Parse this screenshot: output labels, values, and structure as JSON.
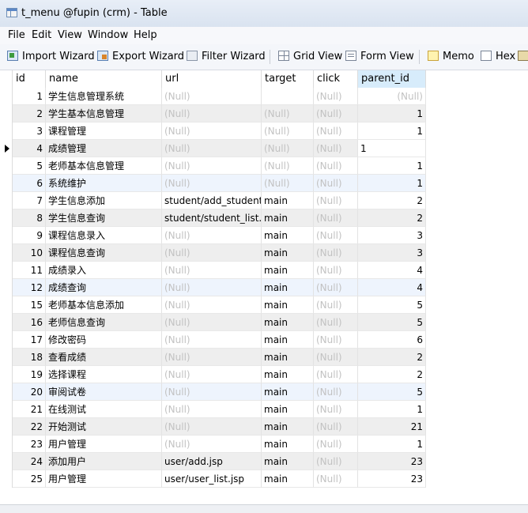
{
  "window": {
    "title": "t_menu @fupin (crm) - Table"
  },
  "menu": [
    "File",
    "Edit",
    "View",
    "Window",
    "Help"
  ],
  "toolbar": {
    "import_wizard": "Import Wizard",
    "export_wizard": "Export Wizard",
    "filter_wizard": "Filter Wizard",
    "grid_view": "Grid View",
    "form_view": "Form View",
    "memo": "Memo",
    "hex": "Hex"
  },
  "table": {
    "columns": [
      "id",
      "name",
      "url",
      "target",
      "click",
      "parent_id"
    ],
    "sorted_column": "parent_id",
    "current_row_index": 3,
    "rows": [
      {
        "id": "1",
        "name": "学生信息管理系统",
        "url": "(Null)",
        "target": "",
        "click": "(Null)",
        "parent_id": "(Null)"
      },
      {
        "id": "2",
        "name": "学生基本信息管理",
        "url": "(Null)",
        "target": "(Null)",
        "click": "(Null)",
        "parent_id": "1"
      },
      {
        "id": "3",
        "name": "课程管理",
        "url": "(Null)",
        "target": "(Null)",
        "click": "(Null)",
        "parent_id": "1"
      },
      {
        "id": "4",
        "name": "成绩管理",
        "url": "(Null)",
        "target": "(Null)",
        "click": "(Null)",
        "parent_id": "1"
      },
      {
        "id": "5",
        "name": "老师基本信息管理",
        "url": "(Null)",
        "target": "(Null)",
        "click": "(Null)",
        "parent_id": "1"
      },
      {
        "id": "6",
        "name": "系统维护",
        "url": "(Null)",
        "target": "(Null)",
        "click": "(Null)",
        "parent_id": "1"
      },
      {
        "id": "7",
        "name": "学生信息添加",
        "url": "student/add_student.",
        "target": "main",
        "click": "(Null)",
        "parent_id": "2"
      },
      {
        "id": "8",
        "name": "学生信息查询",
        "url": "student/student_list.js",
        "target": "main",
        "click": "(Null)",
        "parent_id": "2"
      },
      {
        "id": "9",
        "name": "课程信息录入",
        "url": "(Null)",
        "target": "main",
        "click": "(Null)",
        "parent_id": "3"
      },
      {
        "id": "10",
        "name": "课程信息查询",
        "url": "(Null)",
        "target": "main",
        "click": "(Null)",
        "parent_id": "3"
      },
      {
        "id": "11",
        "name": "成绩录入",
        "url": "(Null)",
        "target": "main",
        "click": "(Null)",
        "parent_id": "4"
      },
      {
        "id": "12",
        "name": "成绩查询",
        "url": "(Null)",
        "target": "main",
        "click": "(Null)",
        "parent_id": "4"
      },
      {
        "id": "15",
        "name": "老师基本信息添加",
        "url": "(Null)",
        "target": "main",
        "click": "(Null)",
        "parent_id": "5"
      },
      {
        "id": "16",
        "name": "老师信息查询",
        "url": "(Null)",
        "target": "main",
        "click": "(Null)",
        "parent_id": "5"
      },
      {
        "id": "17",
        "name": "修改密码",
        "url": "(Null)",
        "target": "main",
        "click": "(Null)",
        "parent_id": "6"
      },
      {
        "id": "18",
        "name": "查看成绩",
        "url": "(Null)",
        "target": "main",
        "click": "(Null)",
        "parent_id": "2"
      },
      {
        "id": "19",
        "name": "选择课程",
        "url": "(Null)",
        "target": "main",
        "click": "(Null)",
        "parent_id": "2"
      },
      {
        "id": "20",
        "name": "审阅试卷",
        "url": "(Null)",
        "target": "main",
        "click": "(Null)",
        "parent_id": "5"
      },
      {
        "id": "21",
        "name": "在线测试",
        "url": "(Null)",
        "target": "main",
        "click": "(Null)",
        "parent_id": "1"
      },
      {
        "id": "22",
        "name": "开始测试",
        "url": "(Null)",
        "target": "main",
        "click": "(Null)",
        "parent_id": "21"
      },
      {
        "id": "23",
        "name": "用户管理",
        "url": "(Null)",
        "target": "main",
        "click": "(Null)",
        "parent_id": "1"
      },
      {
        "id": "24",
        "name": "添加用户",
        "url": "user/add.jsp",
        "target": "main",
        "click": "(Null)",
        "parent_id": "23"
      },
      {
        "id": "25",
        "name": "用户管理",
        "url": "user/user_list.jsp",
        "target": "main",
        "click": "(Null)",
        "parent_id": "23"
      }
    ]
  },
  "colors": {
    "row_even": "#ffffff",
    "row_odd": "#eeeeee",
    "row_highlight": "#eef4fd",
    "null_text": "#c2c2c2",
    "sorted_header": "#d7ecfb"
  }
}
